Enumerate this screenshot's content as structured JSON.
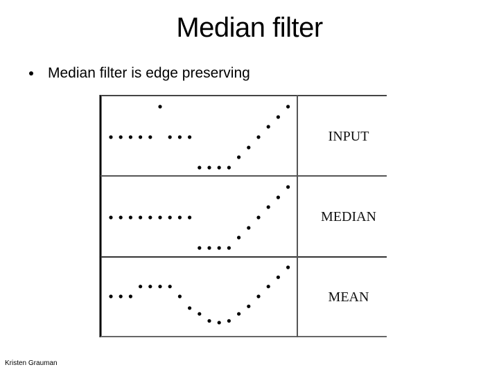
{
  "slide": {
    "title": "Median filter",
    "bullets": [
      "Median filter is edge preserving"
    ],
    "footer": "Kristen Grauman"
  },
  "chart_data": {
    "type": "scatter",
    "title": "",
    "xlabel": "",
    "ylabel": "",
    "grid": false,
    "x": [
      1,
      2,
      3,
      4,
      5,
      6,
      7,
      8,
      9,
      10,
      11,
      12,
      13,
      14,
      15,
      16,
      17,
      18,
      19
    ],
    "ylim": [
      0,
      10
    ],
    "series": [
      {
        "name": "INPUT",
        "values": [
          5,
          5,
          5,
          5,
          5,
          10,
          5,
          5,
          5,
          0,
          0,
          0,
          0,
          1.7,
          3.3,
          5,
          6.7,
          8.3,
          10
        ]
      },
      {
        "name": "MEDIAN",
        "values": [
          5,
          5,
          5,
          5,
          5,
          5,
          5,
          5,
          5,
          0,
          0,
          0,
          0,
          1.7,
          3.3,
          5,
          6.7,
          8.3,
          10
        ]
      },
      {
        "name": "MEAN",
        "values": [
          5,
          5,
          5,
          6.7,
          6.7,
          6.7,
          6.7,
          5,
          3,
          2,
          0.8,
          0.5,
          0.8,
          2,
          3.3,
          5,
          6.7,
          8.3,
          10
        ]
      }
    ]
  }
}
